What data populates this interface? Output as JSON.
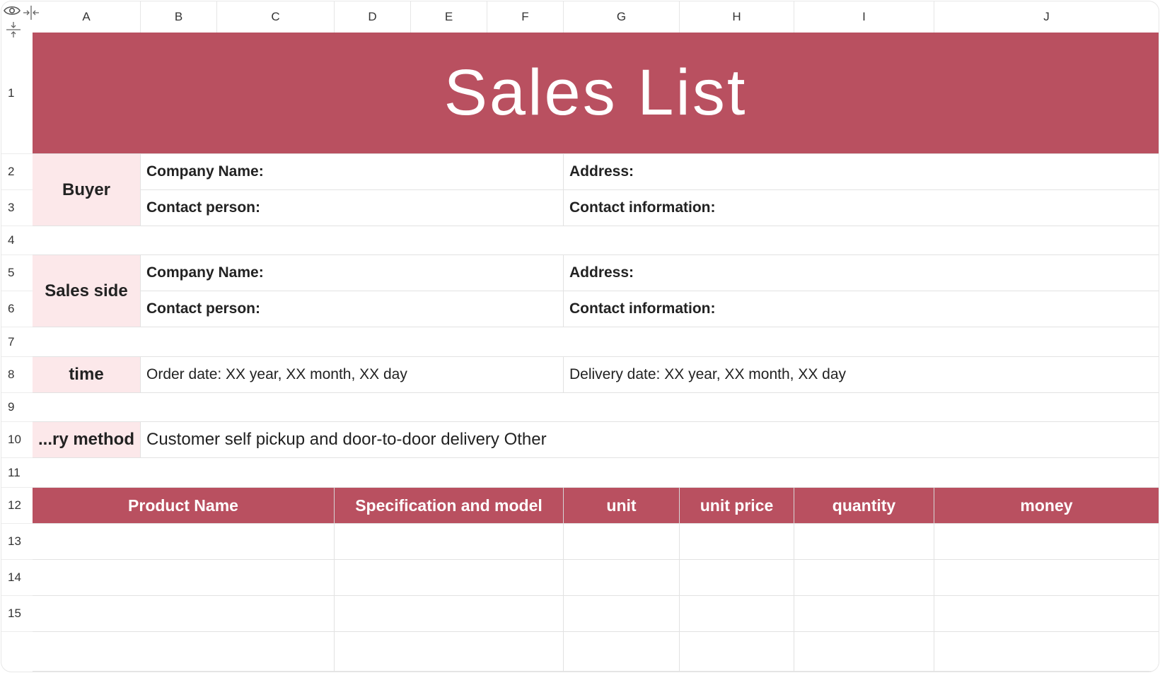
{
  "columns": [
    "A",
    "B",
    "C",
    "D",
    "E",
    "F",
    "G",
    "H",
    "I",
    "J"
  ],
  "rows": [
    "1",
    "2",
    "3",
    "4",
    "5",
    "6",
    "7",
    "8",
    "9",
    "10",
    "11",
    "12",
    "13",
    "14",
    "15"
  ],
  "sheet": {
    "title": "Sales List",
    "buyer": {
      "label": "Buyer",
      "company_name": "Company Name:",
      "address": "Address:",
      "contact_person": "Contact person:",
      "contact_information": "Contact information:"
    },
    "sales_side": {
      "label": "Sales side",
      "company_name": "Company Name:",
      "address": "Address:",
      "contact_person": "Contact person:",
      "contact_information": "Contact information:"
    },
    "time": {
      "label": "time",
      "order_date": "Order date: XX year, XX month, XX day",
      "delivery_date": "Delivery date: XX year, XX month, XX day"
    },
    "delivery": {
      "label": "...ry method",
      "value": "Customer self pickup and door-to-door delivery Other"
    },
    "table_headers": [
      "Product Name",
      "Specification and model",
      "unit",
      "unit price",
      "quantity",
      "money"
    ]
  },
  "colors": {
    "accent": "#b95060",
    "label_fill": "#fce8ea",
    "gridline": "#e2e2e2"
  },
  "icons": [
    "eye-icon",
    "collapse-columns-icon",
    "collapse-rows-icon"
  ]
}
